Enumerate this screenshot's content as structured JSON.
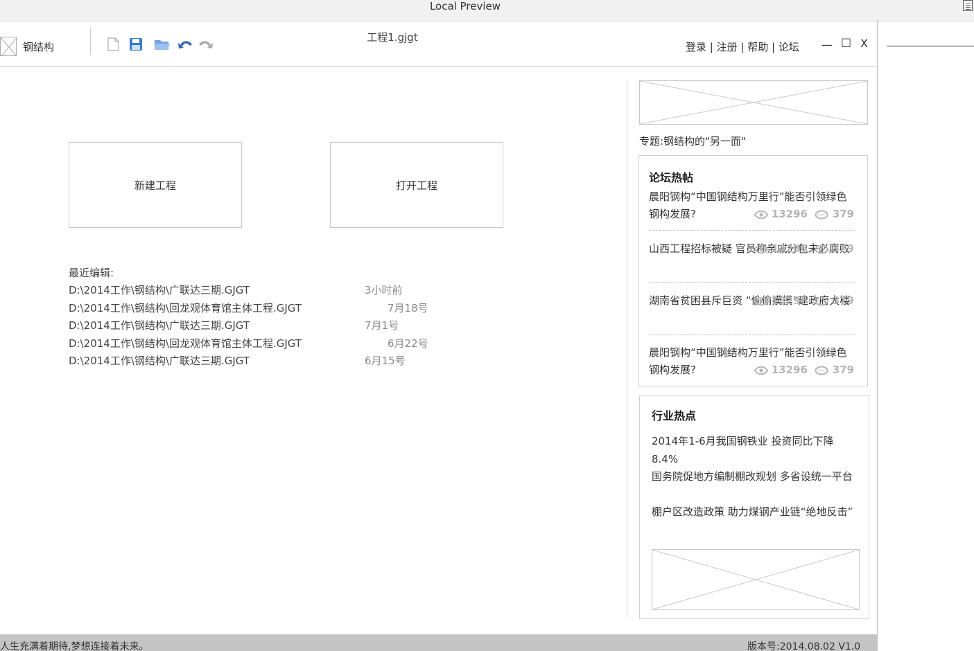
{
  "preview": {
    "title": "Local Preview"
  },
  "app": {
    "name": "钢结构",
    "document_title": "工程1.gjgt",
    "nav": {
      "login": "登录",
      "register": "注册",
      "help": "帮助",
      "forum": "论坛",
      "sep": " | "
    },
    "window_controls": {
      "minimize": "—",
      "maximize": "□",
      "close": "X"
    },
    "toolbar_icons": [
      "new-file-icon",
      "save-icon",
      "open-folder-icon",
      "undo-icon",
      "redo-icon"
    ]
  },
  "main": {
    "new_project": "新建工程",
    "open_project": "打开工程",
    "recent_label": "最近编辑:",
    "recent": [
      {
        "path": "D:\\2014工作\\钢结构\\广联达三期.GJGT",
        "time": "3小时前"
      },
      {
        "path": "D:\\2014工作\\钢结构\\回龙观体育馆主体工程.GJGT",
        "time": "7月18号"
      },
      {
        "path": "D:\\2014工作\\钢结构\\广联达三期.GJGT",
        "time": "7月1号"
      },
      {
        "path": "D:\\2014工作\\钢结构\\回龙观体育馆主体工程.GJGT",
        "time": "6月22号"
      },
      {
        "path": "D:\\2014工作\\钢结构\\广联达三期.GJGT",
        "time": "6月15号"
      }
    ]
  },
  "sidebar": {
    "topic": "专题:钢结构的\"另一面\"",
    "forum": {
      "title": "论坛热帖",
      "posts": [
        {
          "title": "晨阳钢构“中国钢结构万里行”能否引领绿色钢构发展?",
          "views": "13296",
          "comments": "379"
        },
        {
          "title": "山西工程招标被疑 官员称亲戚分包未必腐败",
          "views": "13296",
          "comments": "379"
        },
        {
          "title": "湖南省贫困县斥巨资 “偷偷摸摸”建政府大楼",
          "views": "13296",
          "comments": "379"
        },
        {
          "title": "晨阳钢构“中国钢结构万里行”能否引领绿色钢构发展?",
          "views": "13296",
          "comments": "379"
        }
      ]
    },
    "industry": {
      "title": "行业热点",
      "items": [
        "2014年1-6月我国钢铁业 投资同比下降8.4%",
        "国务院促地方编制棚改规划 多省设统一平台",
        "棚户区改造政策 助力煤钢产业链“绝地反击”"
      ]
    }
  },
  "status": {
    "slogan": "人生充满着期待,梦想连接着未来。",
    "version": "版本号:2014.08.02 V1.0"
  }
}
